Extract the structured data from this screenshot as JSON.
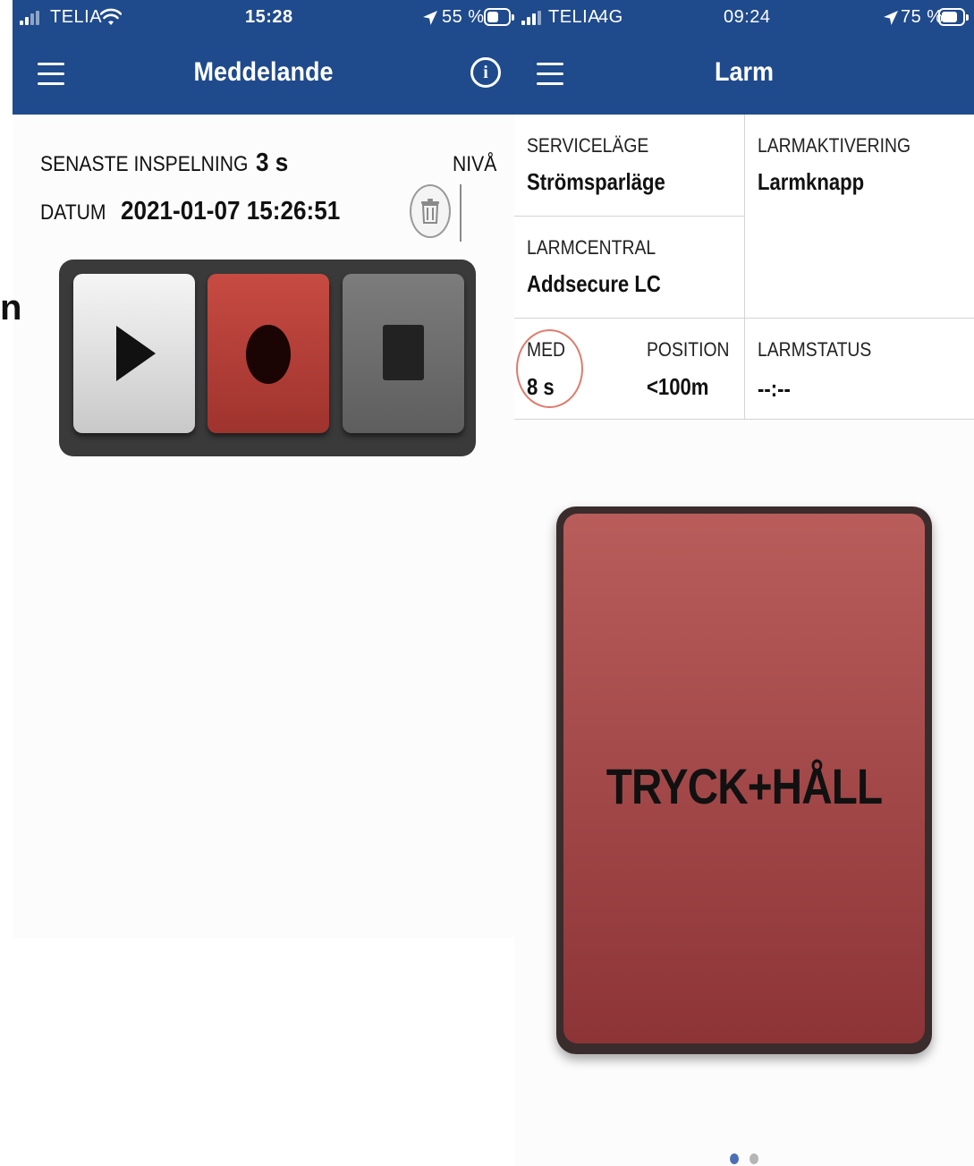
{
  "left_screen": {
    "status": {
      "carrier": "TELIA",
      "time": "15:28",
      "battery": "55 %",
      "battery_level": 0.55
    },
    "nav": {
      "title": "Meddelande"
    },
    "recording": {
      "last_label": "SENASTE INSPELNING",
      "last_value": "3 s",
      "level_label": "NIVÅ",
      "date_label": "DATUM",
      "date_value": "2021-01-07 15:26:51"
    },
    "controls": [
      "play",
      "record",
      "stop"
    ]
  },
  "right_screen": {
    "status": {
      "carrier": "TELIA",
      "network": "4G",
      "time": "09:24",
      "battery": "75 %",
      "battery_level": 0.75
    },
    "nav": {
      "title": "Larm"
    },
    "info": {
      "service_label": "SERVICELÄGE",
      "service_value": "Strömsparläge",
      "activation_label": "LARMAKTIVERING",
      "activation_value": "Larmknapp",
      "central_label": "LARMCENTRAL",
      "central_value": "Addsecure LC",
      "med_label": "MED",
      "med_value": "8 s",
      "position_label": "POSITION",
      "position_value": "<100m",
      "status_label": "LARMSTATUS",
      "status_value": "--:--"
    },
    "alarm_button": {
      "label": "TRYCK+HÅLL"
    },
    "page_dots": {
      "count": 2,
      "active": 0
    }
  },
  "edge_glyph": "n",
  "colors": {
    "nav_blue": "#1f4a8c",
    "record_red": "#b8443c",
    "alarm_red": "#a84848",
    "dot_active": "#4a6fb5",
    "dot_inactive": "#b5b5b5"
  }
}
